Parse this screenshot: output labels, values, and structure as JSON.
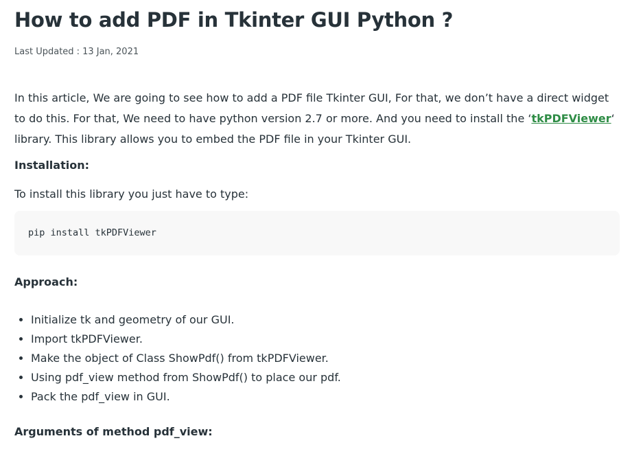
{
  "article": {
    "title": "How to add PDF in Tkinter GUI Python ?",
    "updated_label": "Last Updated :",
    "updated_date": "13 Jan, 2021",
    "intro": {
      "before_link": "In this article, We are going to see how to add a PDF file Tkinter GUI, For that, we don’t have a direct widget to do this. For that, We need to have python version 2.7 or more. And you need to install the ‘",
      "link_text": "tkPDFViewer",
      "after_link": "‘ library. This library allows you to embed the PDF file in your Tkinter GUI."
    },
    "installation_heading": "Installation:",
    "install_text": "To install this library you just have to type:",
    "code": "pip install tkPDFViewer",
    "approach_heading": "Approach:",
    "steps": [
      "Initialize tk and geometry of our GUI.",
      "Import tkPDFViewer.",
      "Make the object of Class ShowPdf() from tkPDFViewer.",
      "Using pdf_view method from ShowPdf() to place our pdf.",
      "Pack the pdf_view in GUI."
    ],
    "arguments_heading": "Arguments of method pdf_view:"
  },
  "colors": {
    "text": "#273239",
    "link": "#2f8d46",
    "code_bg": "#f8f8f8"
  }
}
